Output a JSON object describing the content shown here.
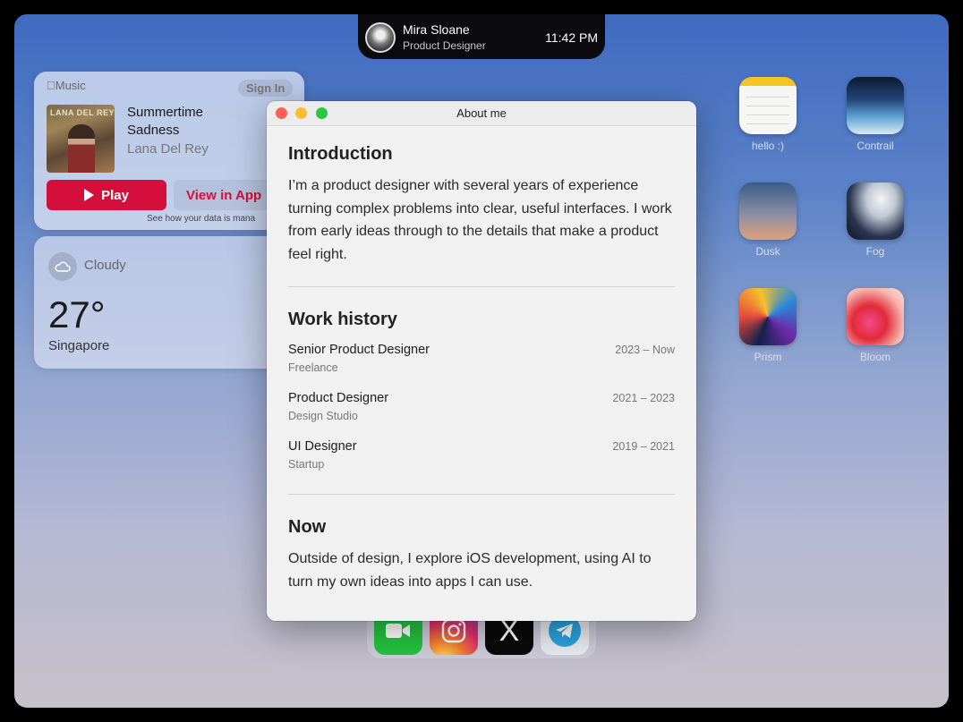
{
  "profile": {
    "name": "Mira Sloane",
    "role": "Product Designer",
    "time": "11:42 PM"
  },
  "music_widget": {
    "brand": "Music",
    "sign_in": "Sign In",
    "cover_text": "LANA DEL REY",
    "song_title": "Summertime Sadness",
    "artist": "Lana Del Rey",
    "play_label": "Play",
    "view_in_app_label": "View in App",
    "data_note": "See how your data is mana",
    "accent_color": "#d40f3b"
  },
  "weather_widget": {
    "condition": "Cloudy",
    "temperature": "27°",
    "city": "Singapore"
  },
  "desktop_icons": [
    {
      "label": "hello :)",
      "icon": "notes-icon"
    },
    {
      "label": "Contrail",
      "icon": "contrail-icon"
    },
    {
      "label": "Dusk",
      "icon": "dusk-icon"
    },
    {
      "label": "Fog",
      "icon": "fog-icon"
    },
    {
      "label": "Prism",
      "icon": "prism-icon"
    },
    {
      "label": "Bloom",
      "icon": "bloom-icon"
    }
  ],
  "dock": {
    "apps": [
      "facetime-icon",
      "instagram-icon",
      "x-icon",
      "telegram-icon"
    ],
    "x_glyph": "X"
  },
  "window": {
    "title": "About me",
    "introduction": {
      "heading": "Introduction",
      "text": "I’m a product designer with several years of experience turning complex problems into clear, useful interfaces. I work from early ideas through to the details that make a product feel right."
    },
    "work_history": {
      "heading": "Work history",
      "jobs": [
        {
          "title": "Senior Product Designer",
          "company": "Freelance",
          "dates": "2023 – Now"
        },
        {
          "title": "Product Designer",
          "company": "Design Studio",
          "dates": "2021 – 2023"
        },
        {
          "title": "UI Designer",
          "company": "Startup",
          "dates": "2019 – 2021"
        }
      ]
    },
    "now": {
      "heading": "Now",
      "text": "Outside of design, I explore iOS development, using AI to turn my own ideas into apps I can use."
    }
  }
}
